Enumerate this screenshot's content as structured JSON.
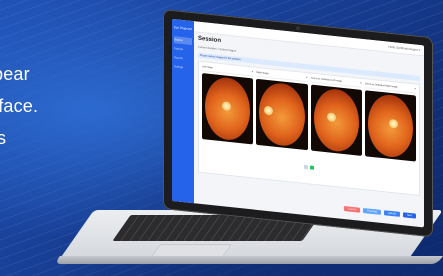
{
  "caption": {
    "line1": "pear",
    "line2": "rface.",
    "line3": "s"
  },
  "app": {
    "logo": "Eye Diagnostics",
    "sidebar_items": [
      "Session",
      "Patients",
      "Reports",
      "Settings"
    ],
    "user": "Hello  Ophthalmologist ▾",
    "page_title": "Session",
    "breadcrumb": "Current Session  >  Select Images",
    "info_text": "Please select images for the session",
    "images": [
      {
        "label": "Left Image",
        "close": "✕"
      },
      {
        "label": "Right Image",
        "close": "✕"
      },
      {
        "label": "Select an Undilated Left Image",
        "close": "✕"
      },
      {
        "label": "Select an Undilated Right Image",
        "close": "✕"
      }
    ],
    "pager": [
      "1",
      "2"
    ],
    "buttons": {
      "cancel": "Cancel",
      "previous": "Previous",
      "upload": "Upload",
      "next": "Next"
    }
  }
}
